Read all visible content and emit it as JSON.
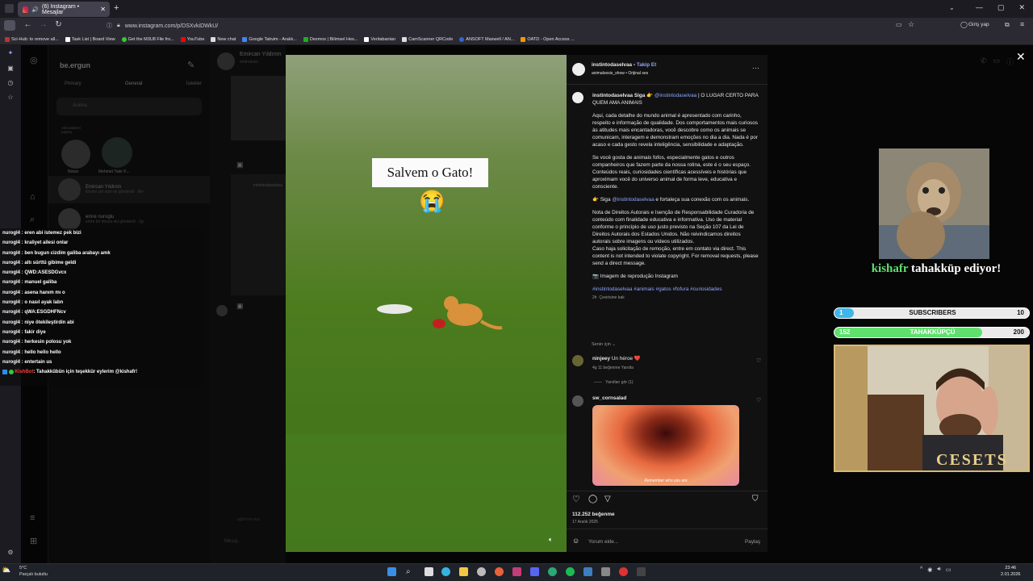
{
  "browser": {
    "tab_title": "(6) Instagram • Mesajlar",
    "url": "www.instagram.com/p/DSXvkiDWkU/",
    "sign_in": "Giriş yap",
    "bookmarks": [
      "Sci-Hub: to remove all...",
      "Task List | Board View",
      "Get the M3U8 File fro...",
      "YouTube",
      "New chat",
      "Google Takvim - Aralık...",
      "Desmos | Bilimsel Hes...",
      "Veritabanları",
      "CamScanner QRCode",
      "ANSOFT Maxwell / AN...",
      "OATD - Open Access ..."
    ]
  },
  "dm": {
    "username": "be.ergun",
    "tabs": [
      "Primary",
      "General",
      "İstekler"
    ],
    "search_placeholder": "Arama",
    "story_labels": [
      "Notun",
      "Mehmet Takir K..."
    ],
    "story_note": "Aklındakileri paylaş",
    "chats": [
      {
        "name": "Emircan Yıldırım",
        "preview": "Ekranı sin size ne gönderdi · 8m"
      },
      {
        "name": "emre nuroglu",
        "preview": "emre bir dosya eki gönderdi · 2g"
      }
    ],
    "conversation_title": "Emircan Yıldırım",
    "conversation_sub": "emircanzx",
    "message_placeholder": "Mesaj...",
    "preview_post_user": "instintodaselvaa",
    "preview_post_user2": "ajjfarmer.mp"
  },
  "twitch_chat": [
    "nurogl4 : eren abi istemez pek bizi",
    "nurogl4 : kraliyet ailesi onlar",
    "nurogl4 : ben bugun cizdim galiba arabayı amk",
    "nurogl4 : altı sürttü gibime geldi",
    "nurogl4 : QWD:ASESDGvcx",
    "nurogl4 : manuel galiba",
    "nurogl4 : asena hanım mı o",
    "nurogl4 : o nasıl ayak labn",
    "nurogl4 : qWA:ESGDHFNcv",
    "nurogl4 : niye ötekileştirdin abi",
    "nurogl4 : fakir diye",
    "nurogl4 : herkesin polosu yok",
    "nurogl4 : hello hello hello",
    "nurogl4 : entertain us"
  ],
  "twitch_last": {
    "user": "KishBot",
    "text": ": Tahakkübün için teşekkür eylerim @kishafr!"
  },
  "video": {
    "caption": "Salvem o Gato!",
    "emoji": "😭"
  },
  "post": {
    "author": "instintodaselvaa",
    "follow": "Takip Et",
    "audio": "animaloosis_show • Orijinal ses",
    "caption_lead": "instintodaselvaa Siga 👉",
    "caption_mention": "@instintodaselvaa",
    "caption_rest": "| O LUGAR CERTO PARA QUEM AMA ANIMAIS",
    "p1": "Aqui, cada detalhe do mundo animal é apresentado com carinho, respeito e informação de qualidade. Dos comportamentos mais curiosos às atitudes mais encantadoras, você descobre como os animais se comunicam, interagem e demonstram emoções no dia a dia. Nada é por acaso e cada gesto revela inteligência, sensibilidade e adaptação.",
    "p2": "Se você gosta de animais fofos, especialmente gatos e outros companheiros que fazem parte da nossa rotina, este é o seu espaço. Conteúdos reais, curiosidades científicas acessíveis e histórias que aproximam você do universo animal de forma leve, educativa e consciente.",
    "p3_lead": "👉 Siga",
    "p3_mention": "@instintodaselvaa",
    "p3_rest": "e fortaleça sua conexão com os animais.",
    "p4": "Nota de Direitos Autorais e Isenção de Responsabilidade Curadoria de conteúdo com finalidade educativa e informativa. Uso de material conforme o princípio de uso justo previsto na Seção 107 da Lei de Direitos Autorais dos Estados Unidos. Não reivindicamos direitos autorais sobre imagens ou vídeos utilizados.",
    "p5": "Caso haja solicitação de remoção, entre em contato via direct. This content is not intended to violate copyright. For removal requests, please send a direct message.",
    "p6": "📷 Imagem de reprodução Instagram",
    "hashtags": "#instintodaselvaa #animais #gatos #fofura #curiosidades",
    "time": "2h",
    "translate": "Çevirisine bak",
    "for_you": "Senin için",
    "comment1_user": "ninjeey",
    "comment1_text": "Un héroe ❤️",
    "comment1_meta": "4g   11 beğenme   Yanıtla",
    "view_replies": "Yanıtları gör (1)",
    "comment2_user": "sw_cornsalad",
    "gif_caption": "Remember who you are",
    "likes": "112.252 beğenme",
    "date": "17 Aralık 2025",
    "comment_placeholder": "Yorum ekle...",
    "share": "Paylaş"
  },
  "overlay": {
    "alert_user": "kishafr",
    "alert_text": "tahakküp ediyor!",
    "subscribers_label": "SUBSCRIBERS",
    "subscribers_current": "1",
    "subscribers_goal": "10",
    "subscribers_progress": 0.1,
    "tahakkup_label": "TAHAKKÜPÇÜ",
    "tahakkup_current": "152",
    "tahakkup_goal": "200",
    "tahakkup_progress": 0.76,
    "cam_text": "CESETS"
  },
  "taskbar": {
    "temp": "5°C",
    "weather": "Parçalı bulutlu",
    "time": "23:46",
    "date": "2.01.2026"
  },
  "colors": {
    "accent_blue": "#8ea6ff",
    "sub_bar": "#3fb6e8",
    "tah_bar": "#5fe06e",
    "grass": "#4a7a20"
  }
}
